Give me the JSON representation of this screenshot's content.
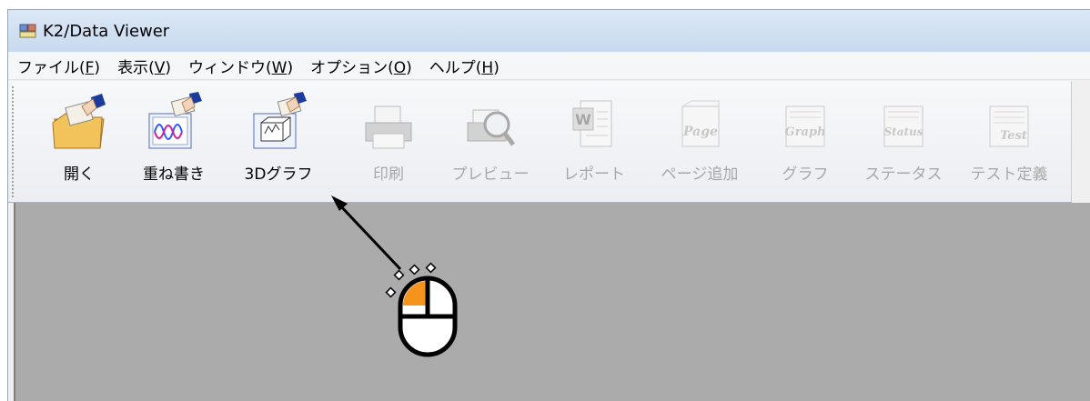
{
  "window": {
    "title": "K2/Data Viewer"
  },
  "menu": [
    {
      "label": "ファイル",
      "paren_open": "(",
      "accel": "F",
      "paren_close": ")"
    },
    {
      "label": "表示",
      "paren_open": "(",
      "accel": "V",
      "paren_close": ")"
    },
    {
      "label": "ウィンドウ",
      "paren_open": "(",
      "accel": "W",
      "paren_close": ")"
    },
    {
      "label": "オプション",
      "paren_open": "(",
      "accel": "O",
      "paren_close": ")"
    },
    {
      "label": "ヘルプ",
      "paren_open": "(",
      "accel": "H",
      "paren_close": ")"
    }
  ],
  "toolbar": {
    "open": "開く",
    "overlay": "重ね書き",
    "graph3d": "3Dグラフ",
    "print": "印刷",
    "preview": "プレビュー",
    "report": "レポート",
    "add_page": "ページ追加",
    "graph": "グラフ",
    "status": "ステータス",
    "test_def": "テスト定義"
  },
  "icon_text": {
    "word": "W",
    "page": "Page",
    "graph": "Graph",
    "status": "Status",
    "test": "Test"
  },
  "colors": {
    "client_bg": "#ababab",
    "mouse_button_highlight": "#f5941d",
    "disabled_text": "#a8a8a8"
  }
}
